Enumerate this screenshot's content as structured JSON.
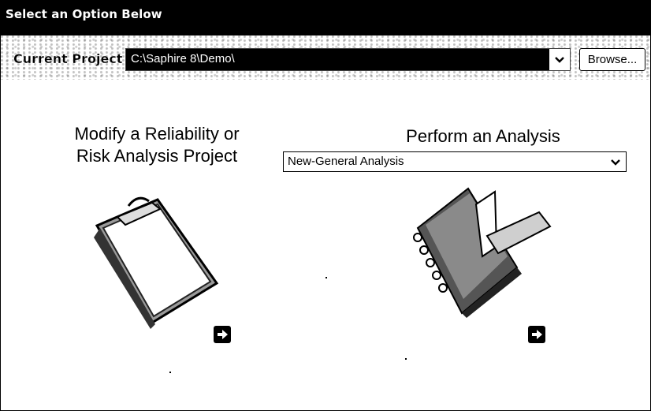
{
  "window": {
    "title": "Select an Option Below"
  },
  "project": {
    "label": "Current Project",
    "path": "C:\\Saphire 8\\Demo\\",
    "browse_label": "Browse..."
  },
  "modify": {
    "heading_line1": "Modify a Reliability or",
    "heading_line2": "Risk Analysis Project"
  },
  "analysis": {
    "heading": "Perform an Analysis",
    "selected": "New-General Analysis"
  },
  "icons": {
    "modify": "clipboard-icon",
    "analysis": "notebook-pen-icon",
    "go": "right-arrow-icon",
    "dropdown": "chevron-down-icon"
  }
}
